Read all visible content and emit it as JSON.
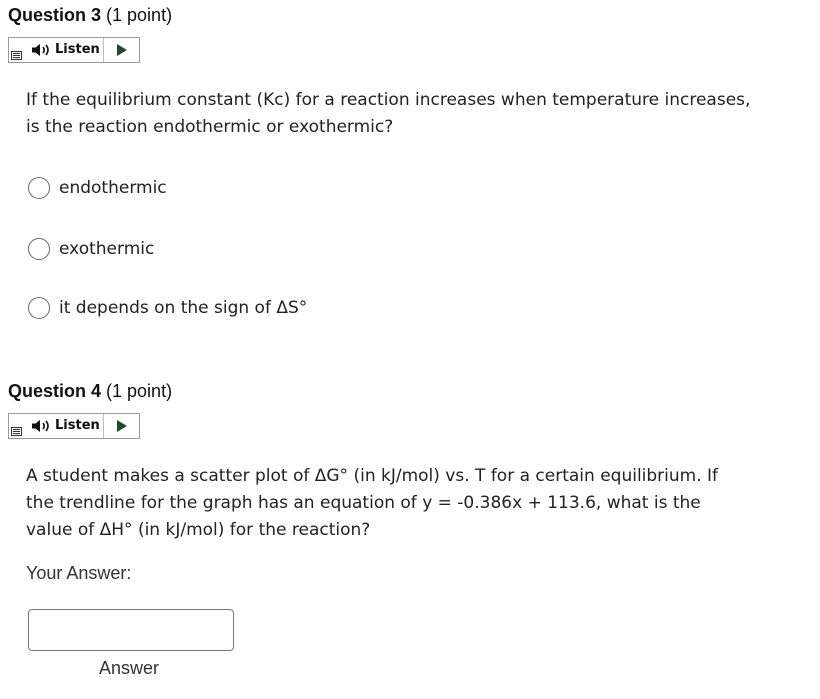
{
  "question3": {
    "number_label": "Question 3",
    "points_label": "(1 point)",
    "listen_label": "Listen",
    "prompt": "If the equilibrium constant (Kc) for a reaction increases when temperature increases, is the reaction endothermic or exothermic?",
    "options": [
      "endothermic",
      "exothermic",
      "it depends on the sign of ΔS°"
    ]
  },
  "question4": {
    "number_label": "Question 4",
    "points_label": "(1 point)",
    "listen_label": "Listen",
    "prompt": "A student makes a scatter plot of ΔG° (in kJ/mol) vs. T for a certain equilibrium. If the trendline for the graph has an equation of y = -0.386x + 113.6, what  is the value of ΔH° (in kJ/mol) for the reaction?",
    "your_answer_label": "Your Answer:",
    "answer_value": "",
    "answer_caption": "Answer"
  }
}
